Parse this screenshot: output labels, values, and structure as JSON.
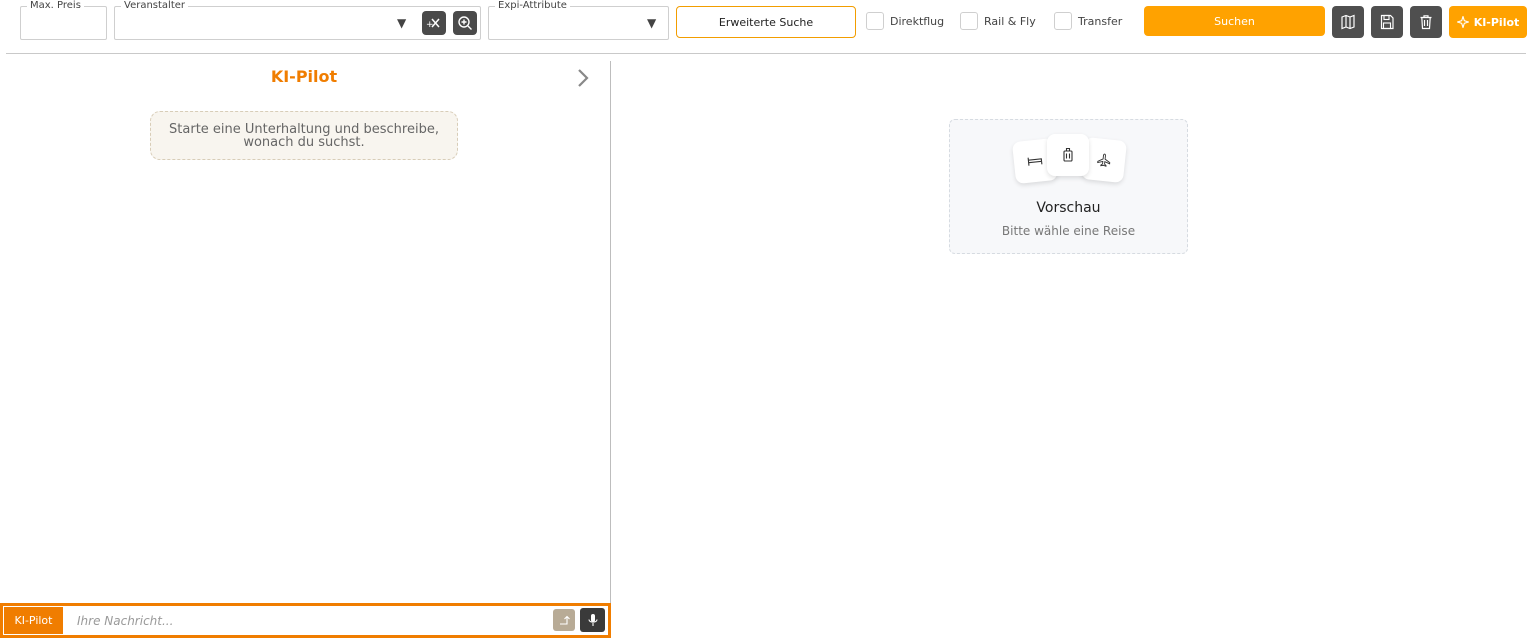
{
  "filters": {
    "max_price_label": "Max. Preis",
    "organizer_label": "Veranstalter",
    "expi_attribute_label": "Expi-Attribute",
    "advanced_search_label": "Erweiterte Suche",
    "checkboxes": [
      {
        "label": "Direktflug",
        "checked": false
      },
      {
        "label": "Rail & Fly",
        "checked": false
      },
      {
        "label": "Transfer",
        "checked": false
      }
    ],
    "search_label": "Suchen",
    "ki_pilot_label": "KI-Pilot",
    "icons": [
      "clear-filter-icon",
      "zoom-in-icon",
      "map-icon",
      "save-icon",
      "trash-icon",
      "sparkle-icon"
    ]
  },
  "chat": {
    "title": "KI-Pilot",
    "hint": "Starte eine Unterhaltung und beschreibe, wonach du suchst.",
    "tag": "KI-Pilot",
    "input_placeholder": "Ihre Nachricht..."
  },
  "preview": {
    "title": "Vorschau",
    "subtitle": "Bitte wähle eine Reise",
    "icons": [
      "bed-icon",
      "luggage-icon",
      "plane-icon"
    ]
  },
  "colors": {
    "accent": "#ffa200",
    "accent_dark": "#f07d00",
    "dark_button": "#4f4f4f"
  }
}
